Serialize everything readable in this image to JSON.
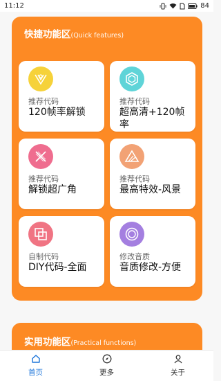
{
  "status": {
    "time": "11:12",
    "battery": "84"
  },
  "quick": {
    "title": "快捷功能区",
    "subtitle": "(Quick features)",
    "cards": [
      {
        "small": "推荐代码",
        "main": "120帧率解锁",
        "color": "#f6d23a",
        "icon": "pubg-logo-icon"
      },
      {
        "small": "推荐代码",
        "main": "超高清+120帧率",
        "color": "#5fd4d8",
        "icon": "hexagon-icon"
      },
      {
        "small": "推荐代码",
        "main": "解锁超广角",
        "color": "#ef6d8f",
        "icon": "crossed-tools-icon"
      },
      {
        "small": "推荐代码",
        "main": "最高特效-风景",
        "color": "#f2a275",
        "icon": "triangle-icon"
      },
      {
        "small": "自制代码",
        "main": "DIY代码-全面",
        "color": "#f07483",
        "icon": "overlap-squares-icon"
      },
      {
        "small": "修改音质",
        "main": "音质修改-方便",
        "color": "#a47fe0",
        "icon": "sound-waves-icon"
      }
    ]
  },
  "practical": {
    "title": "实用功能区",
    "subtitle": "(Practical functions)"
  },
  "nav": [
    {
      "label": "首页",
      "icon": "home-icon",
      "active": true
    },
    {
      "label": "更多",
      "icon": "compass-icon",
      "active": false
    },
    {
      "label": "关于",
      "icon": "user-icon",
      "active": false
    }
  ],
  "colors": {
    "accent": "#fd8a24",
    "nav_active": "#1a73d9"
  }
}
